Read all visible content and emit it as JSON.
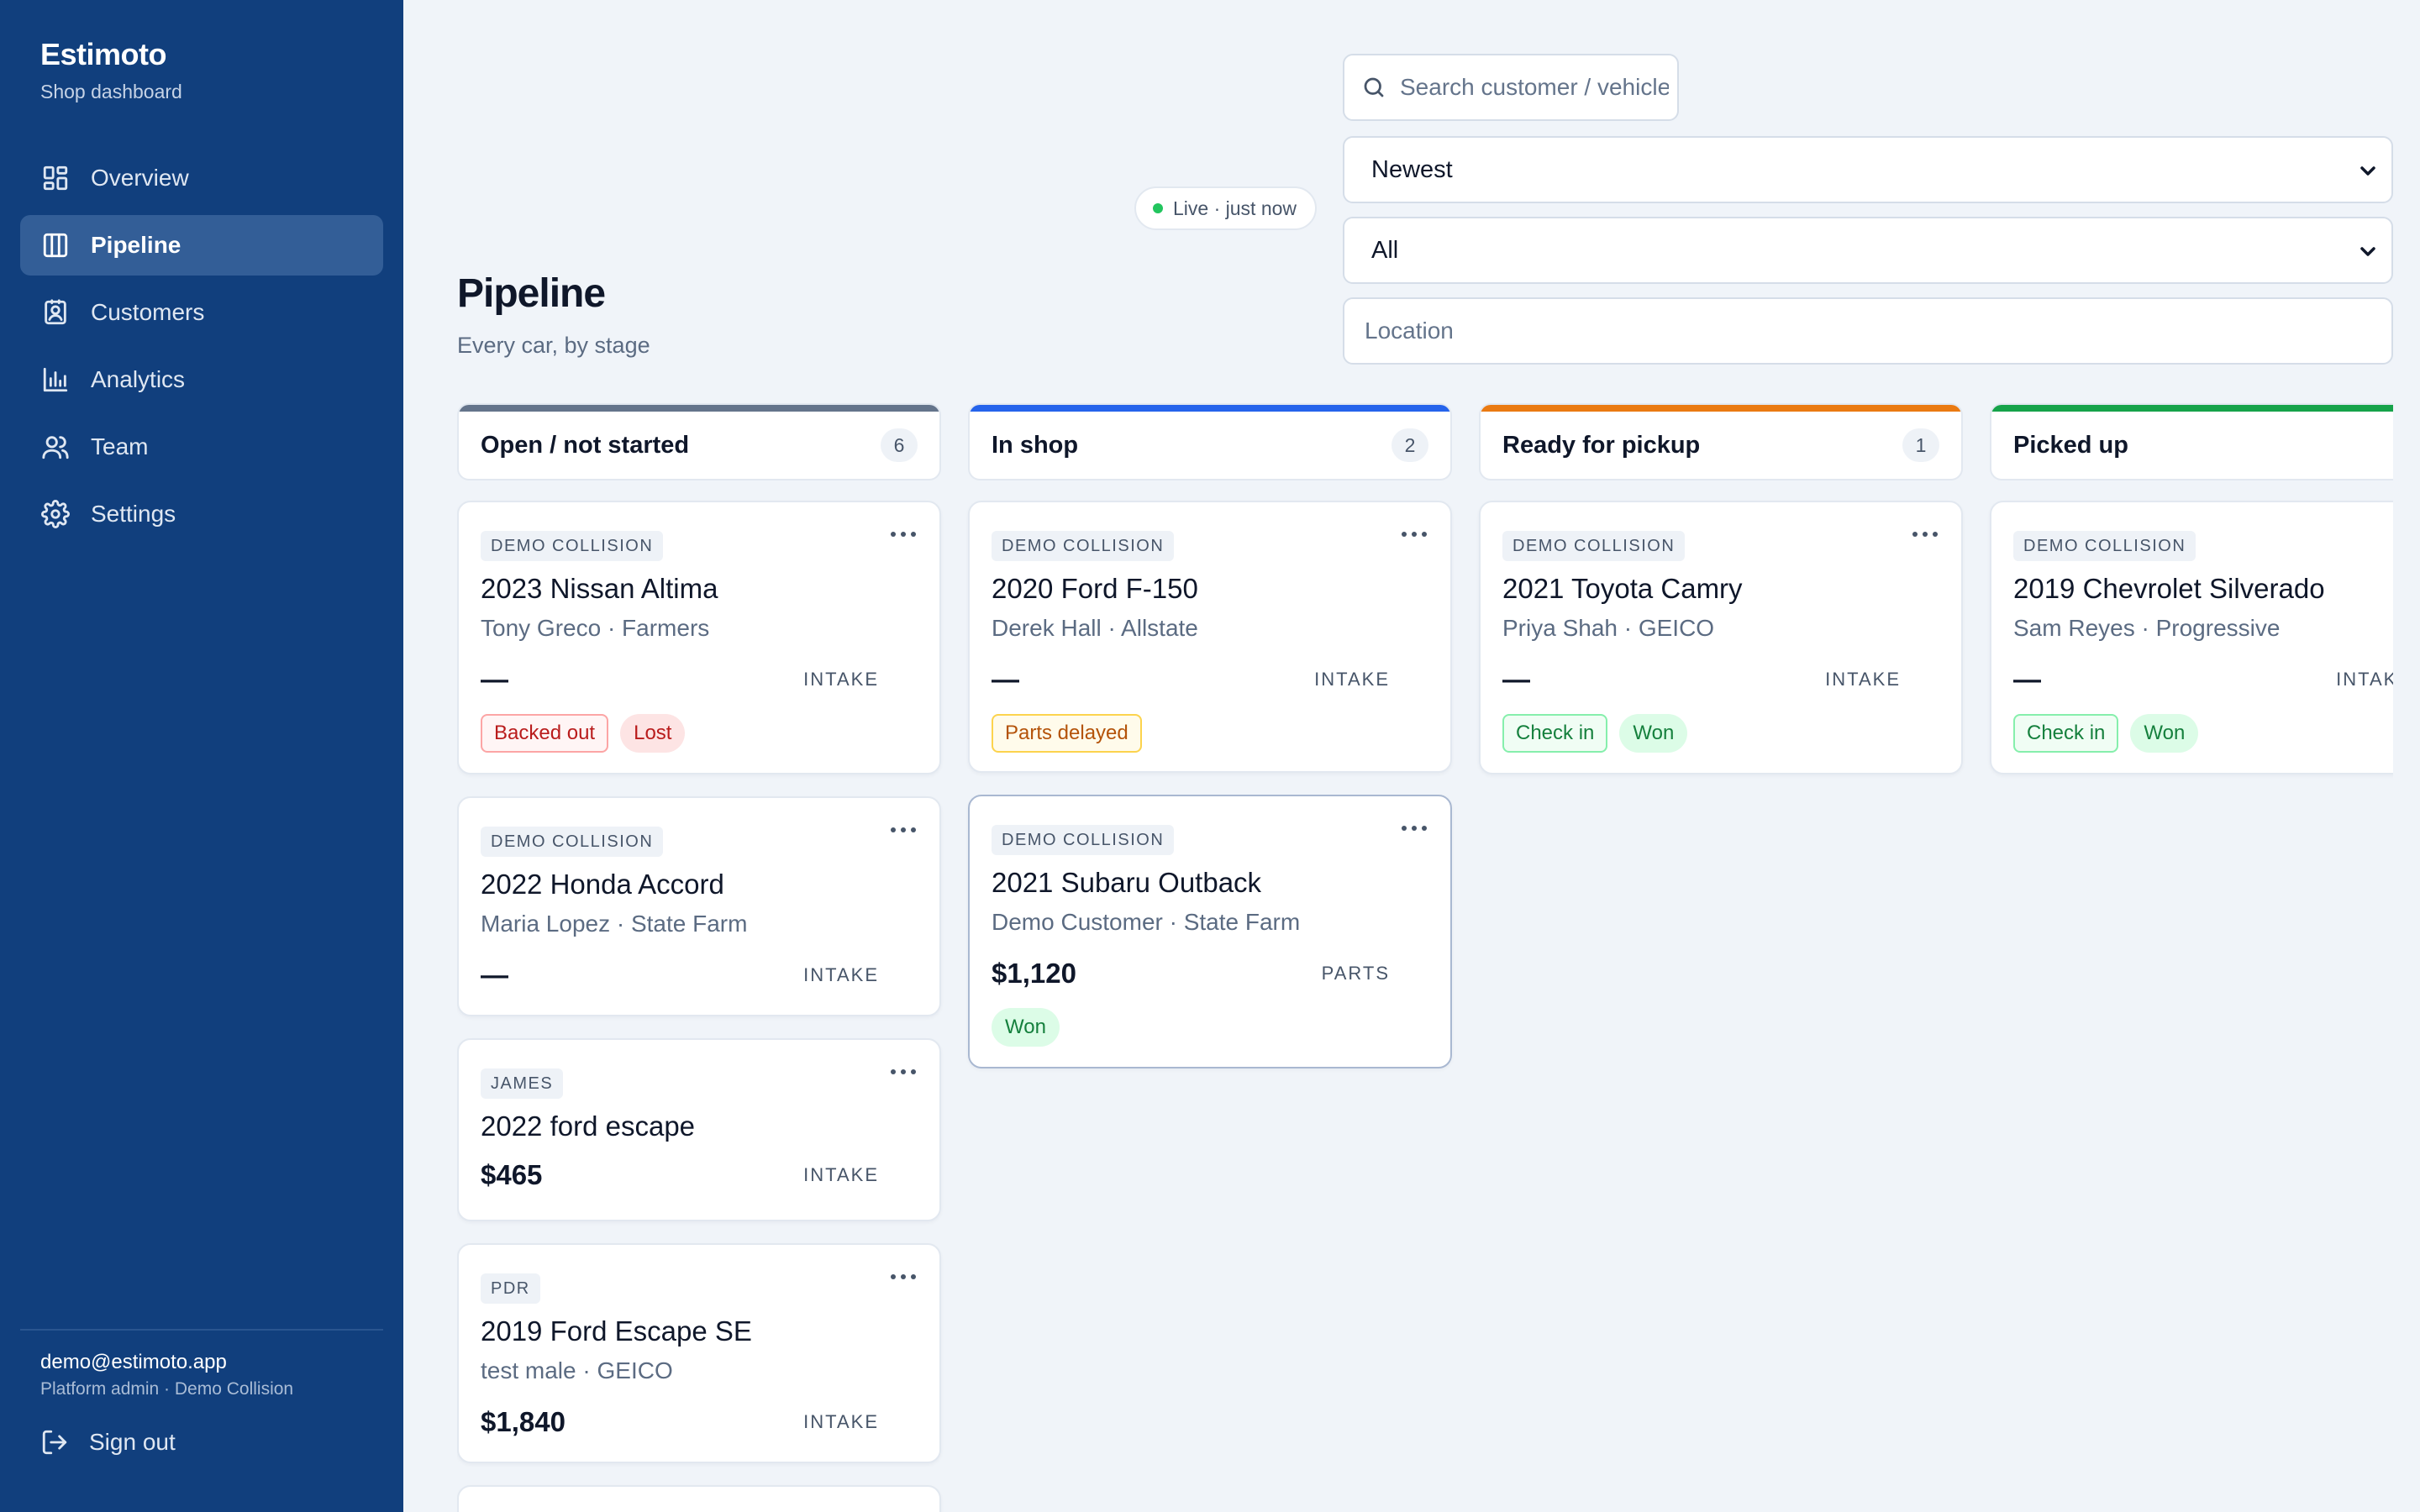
{
  "app": {
    "name": "Estimoto",
    "subtitle": "Shop dashboard"
  },
  "nav": [
    {
      "label": "Overview",
      "icon": "dashboard-icon",
      "active": false
    },
    {
      "label": "Pipeline",
      "icon": "columns-icon",
      "active": true
    },
    {
      "label": "Customers",
      "icon": "contacts-icon",
      "active": false
    },
    {
      "label": "Analytics",
      "icon": "bar-chart-icon",
      "active": false
    },
    {
      "label": "Team",
      "icon": "users-icon",
      "active": false
    },
    {
      "label": "Settings",
      "icon": "gear-icon",
      "active": false
    }
  ],
  "user": {
    "email": "demo@estimoto.app",
    "role": "Platform admin · Demo Collision",
    "signout_label": "Sign out"
  },
  "header": {
    "title": "Pipeline",
    "subtitle": "Every car, by stage",
    "live_status": "Live · just now"
  },
  "filters": {
    "search_placeholder": "Search customer / vehicle",
    "sort_value": "Newest",
    "status_value": "All",
    "location_placeholder": "Location"
  },
  "colors": {
    "sidebar": "#113f7d",
    "open": "#64748b",
    "in_shop": "#2563eb",
    "ready": "#ea7a12",
    "picked_up": "#16a34a"
  },
  "columns": [
    {
      "title": "Open / not started",
      "count": "6",
      "color": "#64748b",
      "cards": [
        {
          "shop": "DEMO COLLISION",
          "vehicle": "2023 Nissan Altima",
          "customer": "Tony Greco · Farmers",
          "amount": "—",
          "stage": "INTAKE",
          "badges": [
            {
              "label": "Backed out",
              "style": "b-red-out"
            },
            {
              "label": "Lost",
              "style": "b-red"
            }
          ]
        },
        {
          "shop": "DEMO COLLISION",
          "vehicle": "2022 Honda Accord",
          "customer": "Maria Lopez · State Farm",
          "amount": "—",
          "stage": "INTAKE",
          "badges": []
        },
        {
          "shop": "JAMES",
          "vehicle": "2022 ford escape",
          "customer": "",
          "amount": "$465",
          "stage": "INTAKE",
          "badges": []
        },
        {
          "shop": "PDR",
          "vehicle": "2019 Ford Escape SE",
          "customer": "test male · GEICO",
          "amount": "$1,840",
          "stage": "INTAKE",
          "badges": []
        }
      ]
    },
    {
      "title": "In shop",
      "count": "2",
      "color": "#2563eb",
      "cards": [
        {
          "shop": "DEMO COLLISION",
          "vehicle": "2020 Ford F-150",
          "customer": "Derek Hall · Allstate",
          "amount": "—",
          "stage": "INTAKE",
          "badges": [
            {
              "label": "Parts delayed",
              "style": "b-amber-out"
            }
          ]
        },
        {
          "shop": "DEMO COLLISION",
          "vehicle": "2021 Subaru Outback",
          "customer": "Demo Customer · State Farm",
          "amount": "$1,120",
          "stage": "PARTS",
          "badges": [
            {
              "label": "Won",
              "style": "b-green"
            }
          ]
        }
      ]
    },
    {
      "title": "Ready for pickup",
      "count": "1",
      "color": "#ea7a12",
      "cards": [
        {
          "shop": "DEMO COLLISION",
          "vehicle": "2021 Toyota Camry",
          "customer": "Priya Shah · GEICO",
          "amount": "—",
          "stage": "INTAKE",
          "badges": [
            {
              "label": "Check in",
              "style": "b-green-out"
            },
            {
              "label": "Won",
              "style": "b-green"
            }
          ]
        }
      ]
    },
    {
      "title": "Picked up",
      "count": "",
      "color": "#16a34a",
      "cards": [
        {
          "shop": "DEMO COLLISION",
          "vehicle": "2019 Chevrolet Silverado",
          "customer": "Sam Reyes · Progressive",
          "amount": "—",
          "stage": "INTAKE",
          "badges": [
            {
              "label": "Check in",
              "style": "b-green-out"
            },
            {
              "label": "Won",
              "style": "b-green"
            }
          ]
        }
      ]
    }
  ]
}
